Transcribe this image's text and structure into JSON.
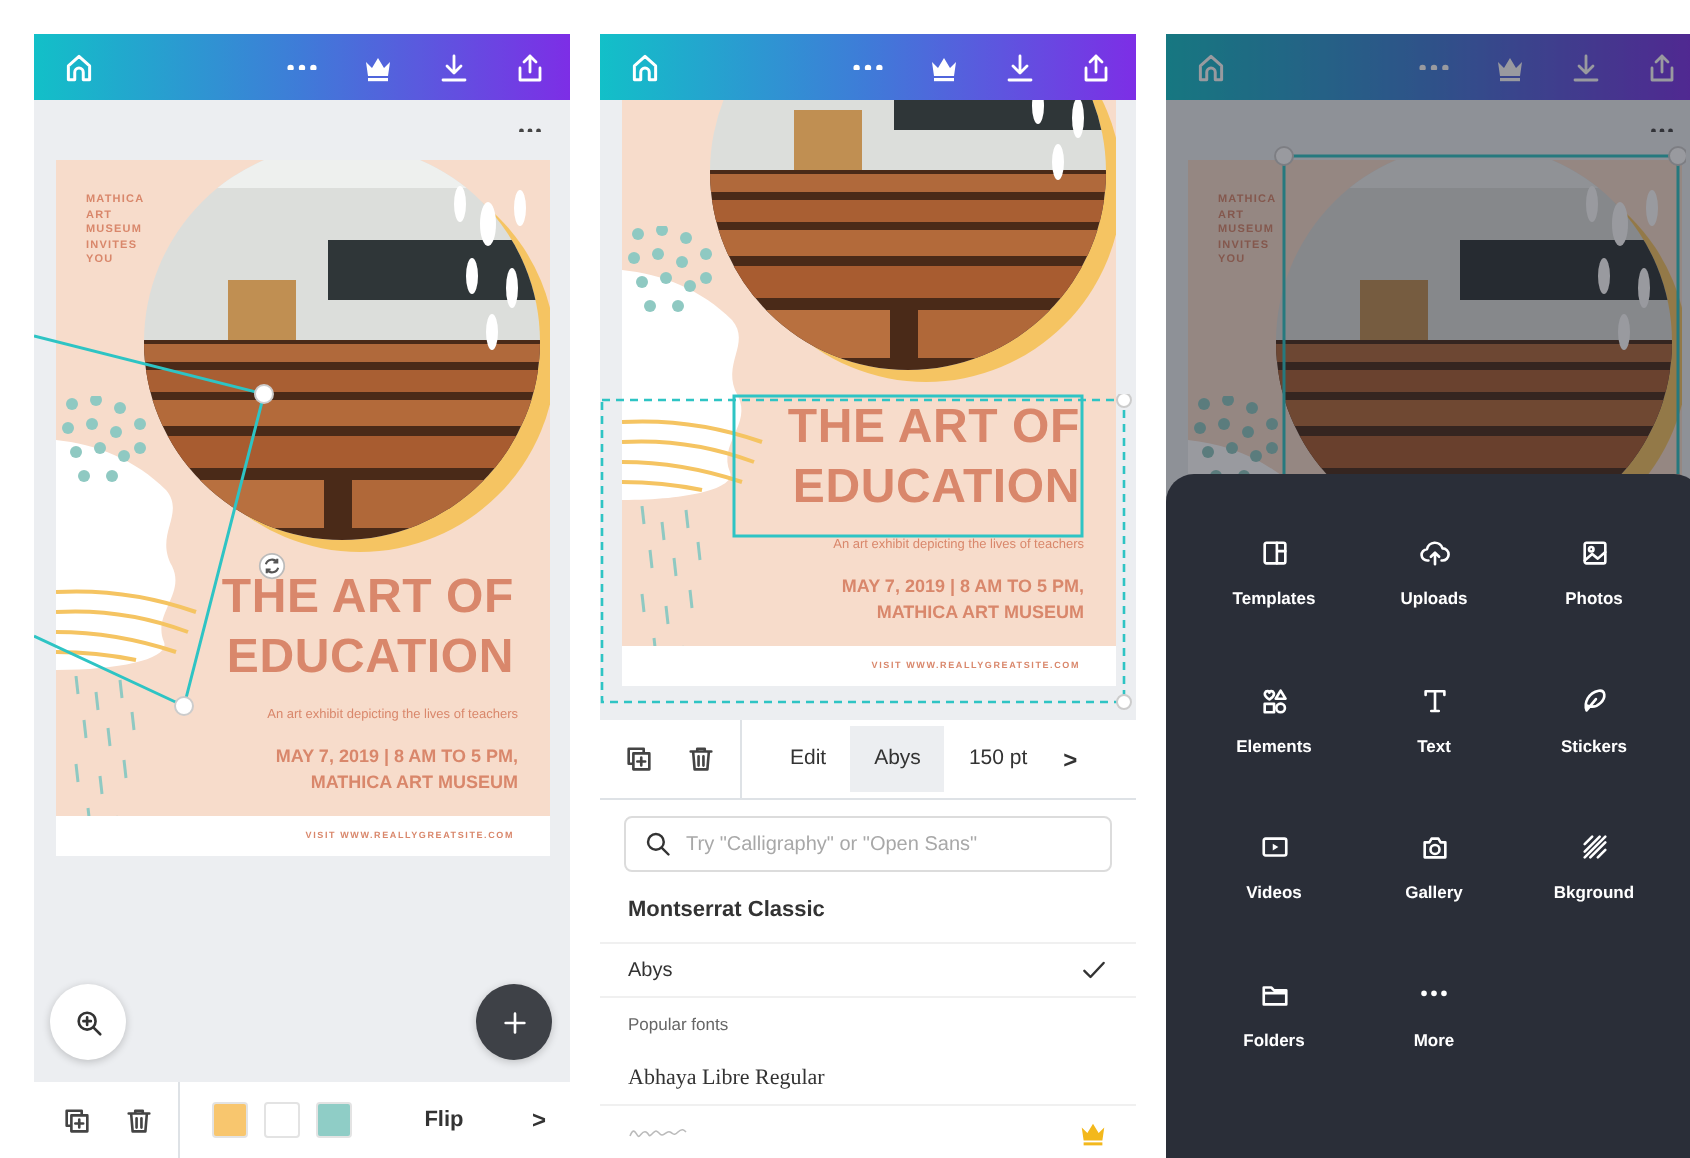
{
  "screens": [
    {
      "kind": "editor",
      "poster": {
        "invite": "MATHICA ART MUSEUM INVITES YOU",
        "title_lines": [
          "THE ART OF",
          "EDUCATION"
        ],
        "subtitle": "An art exhibit depicting the lives of teachers",
        "date_lines": [
          "MAY 7, 2019 | 8 AM TO 5 PM,",
          "MATHICA ART MUSEUM"
        ],
        "footer": "VISIT WWW.REALLYGREATSITE.COM"
      },
      "toolbar": {
        "colors": [
          {
            "color": "#f8c66e"
          },
          {
            "color": "#ffffff"
          },
          {
            "color": "#8fcdc6"
          }
        ],
        "action": "Flip",
        "next": ">"
      }
    },
    {
      "kind": "font_picker",
      "poster": {
        "title_lines": [
          "THE ART OF",
          "EDUCATION"
        ],
        "subtitle": "An art exhibit depicting the lives of teachers",
        "date_lines": [
          "MAY 7, 2019 | 8 AM TO 5 PM,",
          "MATHICA ART MUSEUM"
        ],
        "footer": "VISIT WWW.REALLYGREATSITE.COM"
      },
      "tabs": [
        {
          "label": "Edit",
          "selected": false
        },
        {
          "label": "Abys",
          "selected": true
        },
        {
          "label": "150 pt",
          "selected": false
        }
      ],
      "next": ">",
      "search": {
        "placeholder": "Try \"Calligraphy\" or \"Open Sans\""
      },
      "fonts": [
        {
          "kind": "heading",
          "label": "Montserrat Classic"
        },
        {
          "kind": "font",
          "label": "Abys",
          "checked": true
        },
        {
          "kind": "section",
          "label": "Popular fonts"
        },
        {
          "kind": "font",
          "label": "Abhaya Libre Regular",
          "checked": false
        },
        {
          "kind": "sample",
          "premium": true
        }
      ]
    },
    {
      "kind": "add_menu",
      "poster": {
        "invite": "MATHICA ART MUSEUM INVITES YOU"
      },
      "menu": [
        {
          "label": "Templates"
        },
        {
          "label": "Uploads"
        },
        {
          "label": "Photos"
        },
        {
          "label": "Elements"
        },
        {
          "label": "Text"
        },
        {
          "label": "Stickers"
        },
        {
          "label": "Videos"
        },
        {
          "label": "Gallery"
        },
        {
          "label": "Bkground"
        },
        {
          "label": "Folders"
        },
        {
          "label": "More"
        }
      ]
    }
  ]
}
